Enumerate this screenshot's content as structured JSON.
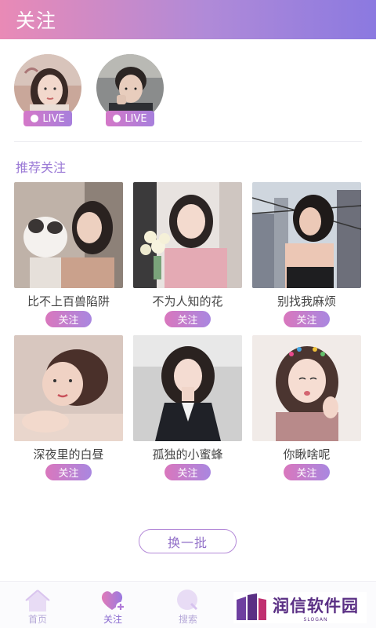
{
  "header": {
    "title": "关注"
  },
  "live_users": [
    {
      "badge": "LIVE"
    },
    {
      "badge": "LIVE"
    }
  ],
  "recommend": {
    "title": "推荐关注",
    "items": [
      {
        "name": "比不上百兽陷阱",
        "button": "关注"
      },
      {
        "name": "不为人知的花",
        "button": "关注"
      },
      {
        "name": "别找我麻烦",
        "button": "关注"
      },
      {
        "name": "深夜里的白昼",
        "button": "关注"
      },
      {
        "name": "孤独的小蜜蜂",
        "button": "关注"
      },
      {
        "name": "你瞅啥呢",
        "button": "关注"
      }
    ]
  },
  "refresh_label": "换一批",
  "tabbar": {
    "tabs": [
      {
        "label": "首页"
      },
      {
        "label": "关注"
      },
      {
        "label": "搜索"
      }
    ]
  },
  "brand": {
    "name": "润信软件园",
    "slogan": "SLOGAN"
  },
  "colors": {
    "accent": "#9b7ad6",
    "gradient_start": "#e98ab6",
    "gradient_end": "#8b79e0"
  }
}
